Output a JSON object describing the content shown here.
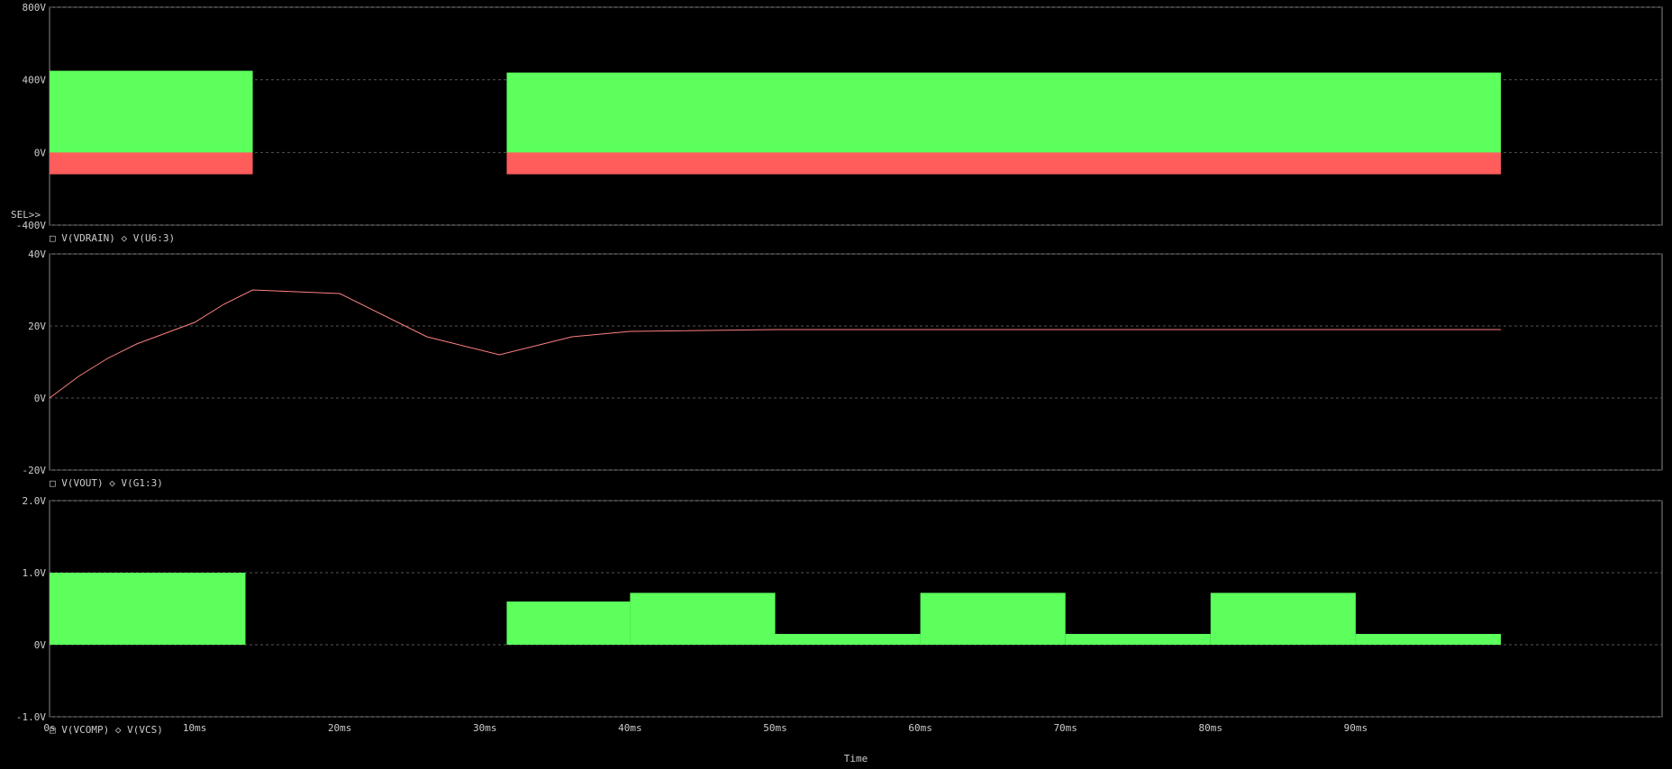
{
  "chart_data": [
    {
      "type": "area",
      "yticks": [
        "800V",
        "400V",
        "0V",
        "-400V"
      ],
      "ylim": [
        -400,
        800
      ],
      "legend": [
        "V(VDRAIN)",
        "V(U6:3)"
      ],
      "sel": "SEL>>",
      "series": [
        {
          "name": "V(VDRAIN)",
          "color": "#5cff5c",
          "bursts": [
            [
              0,
              14,
              -10,
              450
            ],
            [
              31.5,
              100,
              -10,
              440
            ]
          ]
        },
        {
          "name": "V(U6:3)",
          "color": "#ff5c5c",
          "bursts": [
            [
              0,
              14,
              -120,
              0
            ],
            [
              31.5,
              100,
              -120,
              0
            ]
          ]
        }
      ]
    },
    {
      "type": "line",
      "yticks": [
        "40V",
        "20V",
        "0V",
        "-20V"
      ],
      "ylim": [
        -20,
        40
      ],
      "legend": [
        "V(VOUT)",
        "V(G1:3)"
      ],
      "series": [
        {
          "name": "V(VOUT)",
          "color": "#ff8080",
          "x": [
            0,
            2,
            4,
            6,
            8,
            10,
            12,
            14,
            20,
            26,
            31,
            36,
            40,
            50,
            60,
            70,
            80,
            90,
            100
          ],
          "y": [
            0,
            6,
            11,
            15,
            18,
            21,
            26,
            30,
            29,
            17,
            12,
            17,
            18.5,
            19,
            19,
            19,
            19,
            19,
            19
          ]
        }
      ]
    },
    {
      "type": "area",
      "yticks": [
        "2.0V",
        "1.0V",
        "0V",
        "-1.0V"
      ],
      "ylim": [
        -1,
        2
      ],
      "legend": [
        "V(VCOMP)",
        "V(VCS)"
      ],
      "series": [
        {
          "name": "V(VCOMP)",
          "color": "#5cff5c",
          "bursts": [
            [
              0,
              13.5,
              0,
              1.0
            ],
            [
              31.5,
              40,
              0,
              0.6
            ],
            [
              40,
              50,
              0,
              0.72
            ],
            [
              50,
              60,
              0,
              0.15
            ],
            [
              60,
              70,
              0,
              0.72
            ],
            [
              70,
              80,
              0,
              0.15
            ],
            [
              80,
              90,
              0,
              0.72
            ],
            [
              90,
              100,
              0,
              0.15
            ]
          ]
        }
      ]
    }
  ],
  "xticks": [
    "0s",
    "10ms",
    "20ms",
    "30ms",
    "40ms",
    "50ms",
    "60ms",
    "70ms",
    "80ms",
    "90ms"
  ],
  "xlabel": "Time"
}
